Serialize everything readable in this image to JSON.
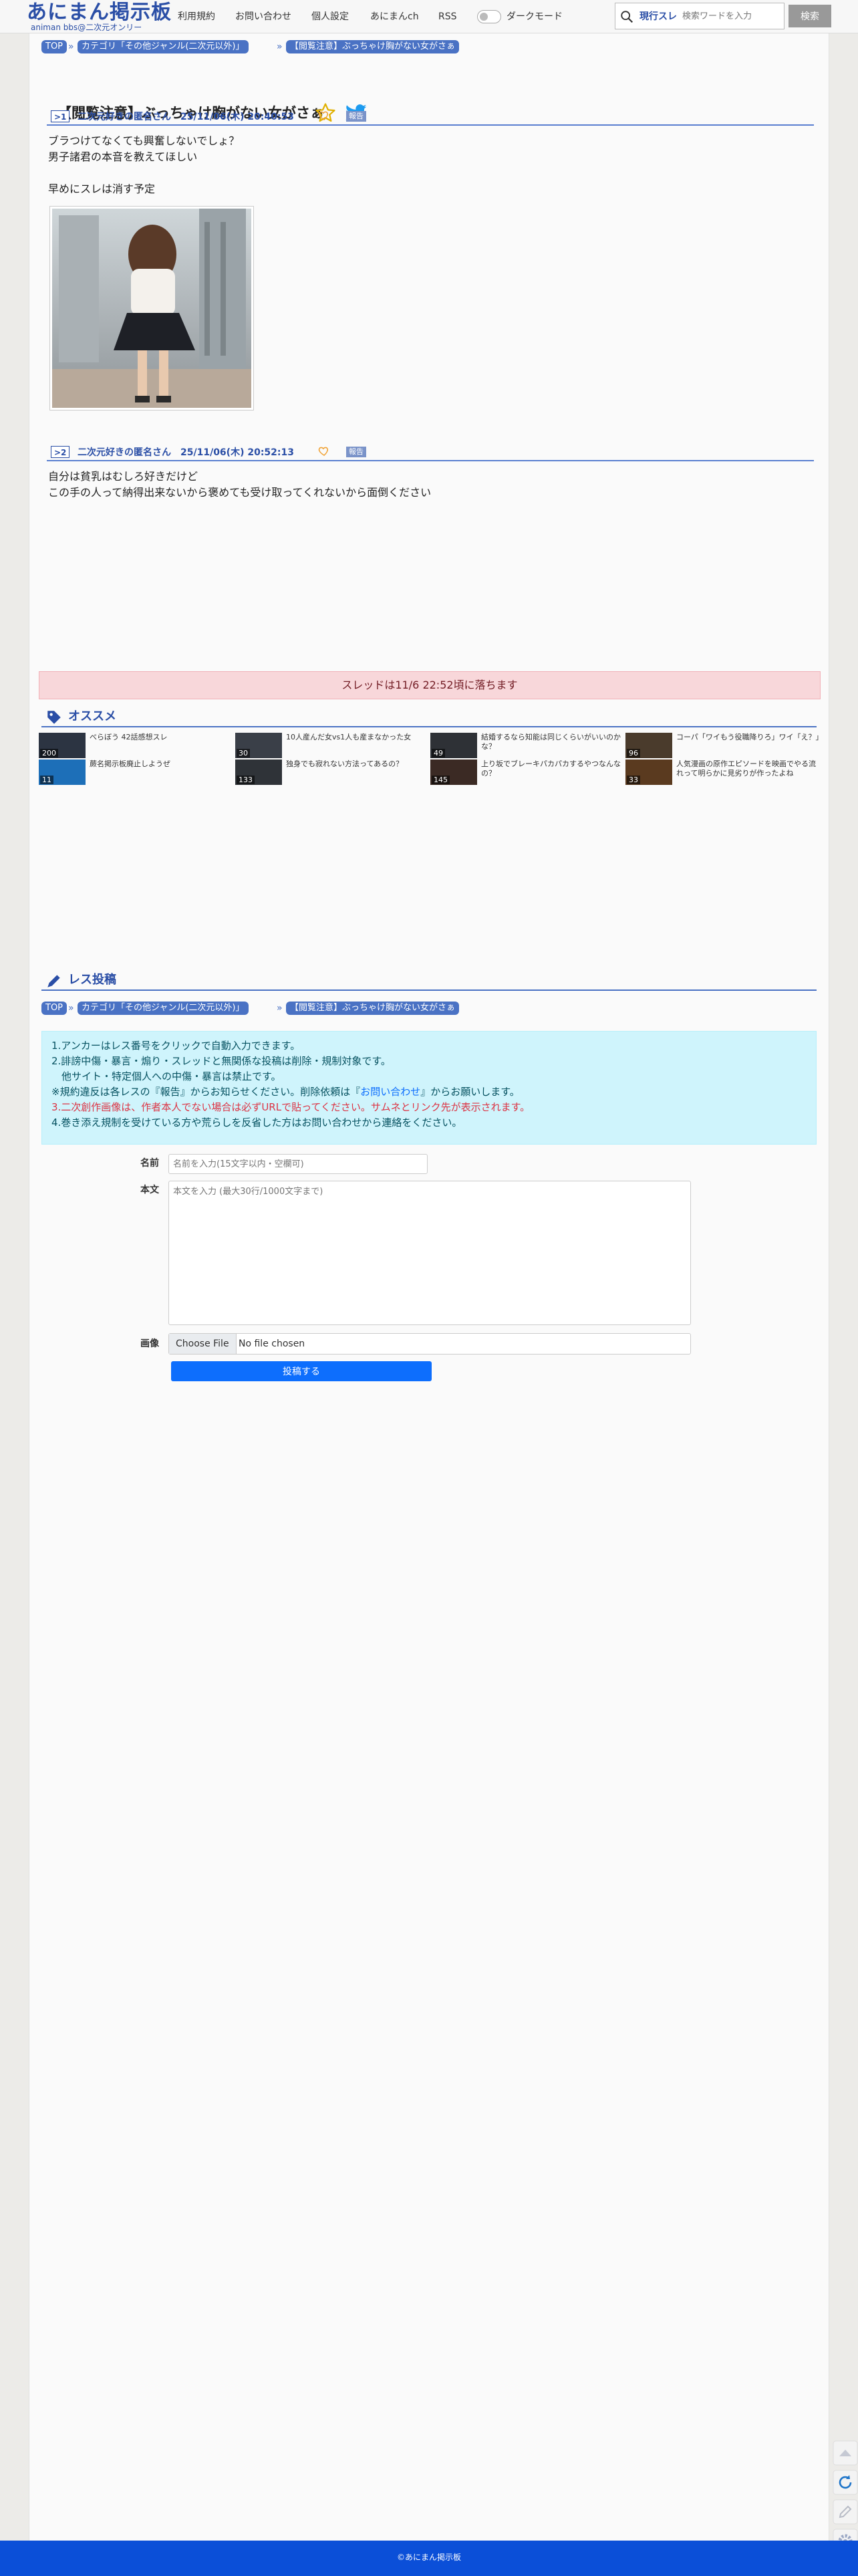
{
  "header": {
    "logo_main": "あにまん掲示板",
    "logo_sub": "animan bbs@二次元オンリー",
    "nav": [
      "利用規約",
      "お問い合わせ",
      "個人設定",
      "あにまんch",
      "RSS"
    ],
    "dark_mode_label": "ダークモード",
    "search_tag": "現行スレ",
    "search_placeholder": "検索ワードを入力",
    "search_button": "検索"
  },
  "breadcrumb": {
    "top": "TOP",
    "category": "カテゴリ「その他ジャンル(二次元以外)」",
    "thread": "【閲覧注意】ぶっちゃけ胸がない女がさぁ",
    "sep": "»"
  },
  "thread": {
    "title": "【閲覧注意】ぶっちゃけ胸がない女がさぁ"
  },
  "posts": [
    {
      "num": ">1",
      "meta": "二次元好きの匿名さん　25/11/06(木) 20:40:53",
      "report": "報告",
      "lines": [
        "ブラつけてなくても興奮しないでしょ？",
        "男子諸君の本音を教えてほしい",
        "",
        "早めにスレは消す予定"
      ]
    },
    {
      "num": ">2",
      "meta": "二次元好きの匿名さん　25/11/06(木) 20:52:13",
      "report": "報告",
      "lines": [
        "自分は貧乳はむしろ好きだけど",
        "この手の人って納得出来ないから褒めても受け取ってくれないから面倒ください"
      ]
    }
  ],
  "drop_notice": "スレッドは11/6 22:52頃に落ちます",
  "recommend": {
    "label": "オススメ",
    "items": [
      {
        "title": "べらぼう 42話感想スレ",
        "count": "200",
        "color": "#2c3442"
      },
      {
        "title": "10人産んだ女vs1人も産まなかった女",
        "count": "30",
        "color": "#3a3f48"
      },
      {
        "title": "結婚するなら知能は同じくらいがいいのかな？",
        "count": "49",
        "color": "#2e3136"
      },
      {
        "title": "コーパ「ワイもう役職降りろ」ワイ「え？」",
        "count": "96",
        "color": "#4a3b2c"
      },
      {
        "title": "蕨名掲示板廃止しようぜ",
        "count": "11",
        "color": "#1d6fb8"
      },
      {
        "title": "独身でも寂れない方法ってあるの？",
        "count": "133",
        "color": "#2f3338"
      },
      {
        "title": "上り坂でブレーキパカパカするやつなんなの？",
        "count": "145",
        "color": "#3b2a24"
      },
      {
        "title": "人気漫画の原作エピソードを映画でやる流れって明らかに見劣りが作ったよね",
        "count": "33",
        "color": "#5a3a1f"
      }
    ]
  },
  "reply": {
    "label": "レス投稿",
    "notes": [
      "1.アンカーはレス番号をクリックで自動入力できます。",
      "2.誹謗中傷・暴言・煽り・スレッドと無関係な投稿は削除・規制対象です。",
      "　他サイト・特定個人への中傷・暴言は禁止です。",
      "※規約違反は各レスの『報告』からお知らせください。削除依頼は『",
      "お問い合わせ",
      "』からお願いします。",
      "3.二次創作画像は、作者本人でない場合は必ずURLで貼ってください。サムネとリンク先が表示されます。",
      "4.巻き添え規制を受けている方や荒らしを反省した方はお問い合わせから連絡をください。"
    ],
    "name_label": "名前",
    "name_placeholder": "名前を入力(15文字以内・空欄可)",
    "body_label": "本文",
    "body_placeholder": "本文を入力 (最大30行/1000文字まで)",
    "image_label": "画像",
    "file_button": "Choose File",
    "file_status": "No file chosen",
    "submit": "投稿する"
  },
  "footer": "©あにまん掲示板",
  "colors": {
    "accent": "#4a72c4",
    "link": "#2a4ea6",
    "footer": "#0b4fd8",
    "submit": "#0d6efd"
  }
}
